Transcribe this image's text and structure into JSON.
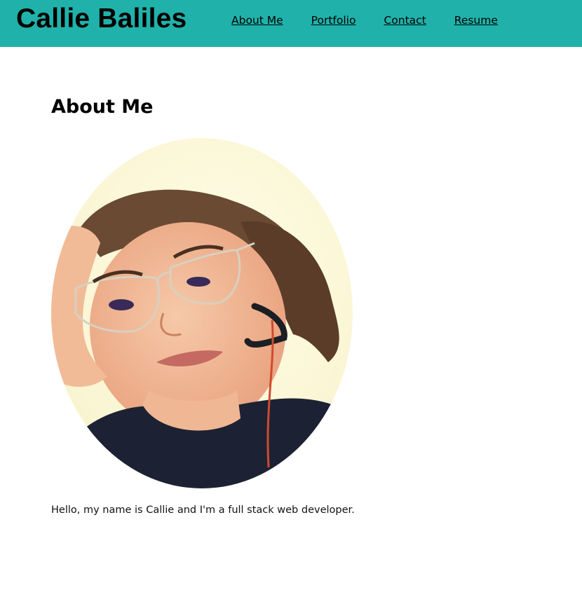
{
  "header": {
    "site_title": "Callie Baliles",
    "background_color": "#20b2aa"
  },
  "nav": {
    "items": [
      {
        "label": "About Me"
      },
      {
        "label": "Portfolio"
      },
      {
        "label": "Contact"
      },
      {
        "label": "Resume"
      }
    ]
  },
  "main": {
    "section_title": "About Me",
    "portrait_alt": "Photo of Callie",
    "intro_text": "Hello, my name is Callie and I'm a full stack web developer."
  }
}
